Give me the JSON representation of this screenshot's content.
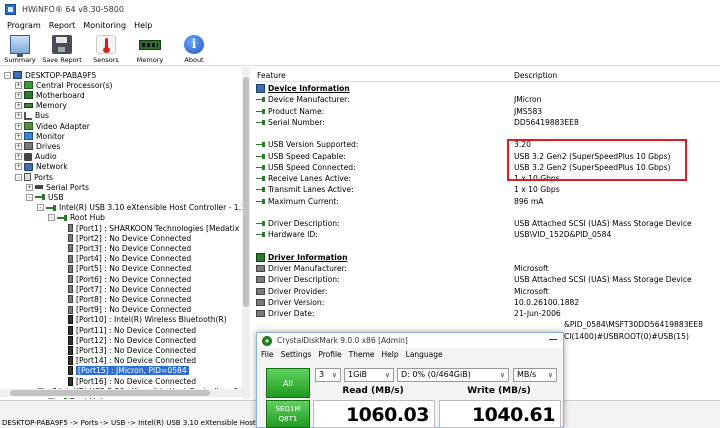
{
  "window": {
    "title": "HWiNFO® 64 v8.30-5800"
  },
  "menu": [
    "Program",
    "Report",
    "Monitoring",
    "Help"
  ],
  "toolbar": [
    {
      "label": "Summary",
      "icon": "summary-icon"
    },
    {
      "label": "Save Report",
      "icon": "save-report-icon"
    },
    {
      "label": "Sensors",
      "icon": "sensors-icon"
    },
    {
      "label": "Memory",
      "icon": "memory-icon"
    },
    {
      "label": "About",
      "icon": "about-icon"
    }
  ],
  "about_glyph": "i",
  "tree": [
    {
      "label": "DESKTOP-PABA9F5",
      "icon": "desk",
      "exp": "-",
      "level": 0
    },
    {
      "label": "Central Processor(s)",
      "icon": "cpu",
      "exp": "+",
      "level": 1
    },
    {
      "label": "Motherboard",
      "icon": "mb",
      "exp": "+",
      "level": 1
    },
    {
      "label": "Memory",
      "icon": "mem",
      "exp": "+",
      "level": 1
    },
    {
      "label": "Bus",
      "icon": "bus",
      "exp": "+",
      "level": 1
    },
    {
      "label": "Video Adapter",
      "icon": "video",
      "exp": "+",
      "level": 1
    },
    {
      "label": "Monitor",
      "icon": "mon",
      "exp": "+",
      "level": 1
    },
    {
      "label": "Drives",
      "icon": "drv",
      "exp": "+",
      "level": 1
    },
    {
      "label": "Audio",
      "icon": "aud",
      "exp": "+",
      "level": 1
    },
    {
      "label": "Network",
      "icon": "net",
      "exp": "+",
      "level": 1
    },
    {
      "label": "Ports",
      "icon": "ports",
      "exp": "-",
      "level": 1
    },
    {
      "label": "Serial Ports",
      "icon": "serial",
      "exp": "+",
      "level": 2
    },
    {
      "label": "USB",
      "icon": "usb",
      "exp": "-",
      "level": 2
    },
    {
      "label": "Intel(R) USB 3.10 eXtensible Host Controller - 1.20",
      "icon": "usb",
      "exp": "-",
      "level": 3
    },
    {
      "label": "Root Hub",
      "icon": "usb",
      "exp": "-",
      "level": 4
    },
    {
      "label": "[Port1] : SHARKOON Technologies [Medatix",
      "icon": "plug",
      "exp": "",
      "level": 5
    },
    {
      "label": "[Port2] : No Device Connected",
      "icon": "plug",
      "exp": "",
      "level": 5
    },
    {
      "label": "[Port3] : No Device Connected",
      "icon": "plug",
      "exp": "",
      "level": 5
    },
    {
      "label": "[Port4] : No Device Connected",
      "icon": "plug",
      "exp": "",
      "level": 5
    },
    {
      "label": "[Port5] : No Device Connected",
      "icon": "plug",
      "exp": "",
      "level": 5
    },
    {
      "label": "[Port6] : No Device Connected",
      "icon": "plug",
      "exp": "",
      "level": 5
    },
    {
      "label": "[Port7] : No Device Connected",
      "icon": "plug",
      "exp": "",
      "level": 5
    },
    {
      "label": "[Port8] : No Device Connected",
      "icon": "plug",
      "exp": "",
      "level": 5
    },
    {
      "label": "[Port9] : No Device Connected",
      "icon": "plug",
      "exp": "",
      "level": 5
    },
    {
      "label": "[Port10] : Intel(R) Wireless Bluetooth(R)",
      "icon": "plugdark",
      "exp": "",
      "level": 5
    },
    {
      "label": "[Port11] : No Device Connected",
      "icon": "plugdark",
      "exp": "",
      "level": 5
    },
    {
      "label": "[Port12] : No Device Connected",
      "icon": "plugdark",
      "exp": "",
      "level": 5
    },
    {
      "label": "[Port13] : No Device Connected",
      "icon": "plugdark",
      "exp": "",
      "level": 5
    },
    {
      "label": "[Port14] : No Device Connected",
      "icon": "plugdark",
      "exp": "",
      "level": 5
    },
    {
      "label": "[Port15] : JMicron, PID=0584",
      "icon": "plugdark",
      "exp": "",
      "level": 5,
      "selected": true
    },
    {
      "label": "[Port16] : No Device Connected",
      "icon": "plugdark",
      "exp": "",
      "level": 5
    },
    {
      "label": "Intel(R) USB 3.20 eXtensible Host Controller - 1.20",
      "icon": "usb",
      "exp": "-",
      "level": 3
    },
    {
      "label": "Root Hub",
      "icon": "usb",
      "exp": "-",
      "level": 4
    }
  ],
  "details_header": {
    "feature": "Feature",
    "description": "Description"
  },
  "details": [
    {
      "type": "section",
      "feature": "Device Information",
      "icon": "usb"
    },
    {
      "feature": "Device Manufacturer:",
      "value": "JMicron",
      "icon": "usb"
    },
    {
      "feature": "Product Name:",
      "value": "JMS583",
      "icon": "usb"
    },
    {
      "feature": "Serial Number:",
      "value": "DD56419883EE8",
      "icon": "usb"
    },
    {
      "type": "blank"
    },
    {
      "feature": "USB Version Supported:",
      "value": "3.20",
      "icon": "usb"
    },
    {
      "feature": "USB Speed Capable:",
      "value": "USB 3.2 Gen2 (SuperSpeedPlus 10 Gbps)",
      "icon": "usb"
    },
    {
      "feature": "USB Speed Connected:",
      "value": "USB 3.2 Gen2 (SuperSpeedPlus 10 Gbps)",
      "icon": "usb"
    },
    {
      "feature": "Receive Lanes Active:",
      "value": "1 x 10 Gbps",
      "icon": "usb"
    },
    {
      "feature": "Transmit Lanes Active:",
      "value": "1 x 10 Gbps",
      "icon": "usb"
    },
    {
      "feature": "Maximum Current:",
      "value": "896 mA",
      "icon": "usb"
    },
    {
      "type": "blank"
    },
    {
      "feature": "Driver Description:",
      "value": "USB Attached SCSI (UAS) Mass Storage Device",
      "icon": "usb"
    },
    {
      "feature": "Hardware ID:",
      "value": "USB\\VID_152D&PID_0584",
      "icon": "usb"
    },
    {
      "type": "blank"
    },
    {
      "type": "section",
      "feature": "Driver Information",
      "icon": "drv"
    },
    {
      "feature": "Driver Manufacturer:",
      "value": "Microsoft",
      "icon": "drv"
    },
    {
      "feature": "Driver Description:",
      "value": "USB Attached SCSI (UAS) Mass Storage Device",
      "icon": "drv"
    },
    {
      "feature": "Driver Provider:",
      "value": "Microsoft",
      "icon": "drv"
    },
    {
      "feature": "Driver Version:",
      "value": "10.0.26100.1882",
      "icon": "drv"
    },
    {
      "feature": "Driver Date:",
      "value": "21-Jun-2006",
      "icon": "drv"
    },
    {
      "feature": "",
      "value": "&PID_0584\\MSFT30DD56419883EE8",
      "icon": "",
      "value_offset": true
    },
    {
      "feature": "",
      "value": "CI(1400)#USBROOT(0)#USB(15)",
      "icon": "",
      "value_offset2": true
    }
  ],
  "statusbar": "DESKTOP-PABA9F5 -> Ports -> USB -> Intel(R) USB 3.10 eXtensible Host Contro",
  "cdm": {
    "title": "CrystalDiskMark 9.0.0 x86 [Admin]",
    "menu": [
      "File",
      "Settings",
      "Profile",
      "Theme",
      "Help",
      "Language"
    ],
    "all_label": "All",
    "count": "3",
    "size": "1GiB",
    "drive": "D: 0% (0/464GiB)",
    "unit": "MB/s",
    "read_header": "Read (MB/s)",
    "write_header": "Write (MB/s)",
    "test_line1": "SEQ1M",
    "test_line2": "Q8T1",
    "read_value": "1060.03",
    "write_value": "1040.61",
    "accent": "#1f9a1f"
  }
}
